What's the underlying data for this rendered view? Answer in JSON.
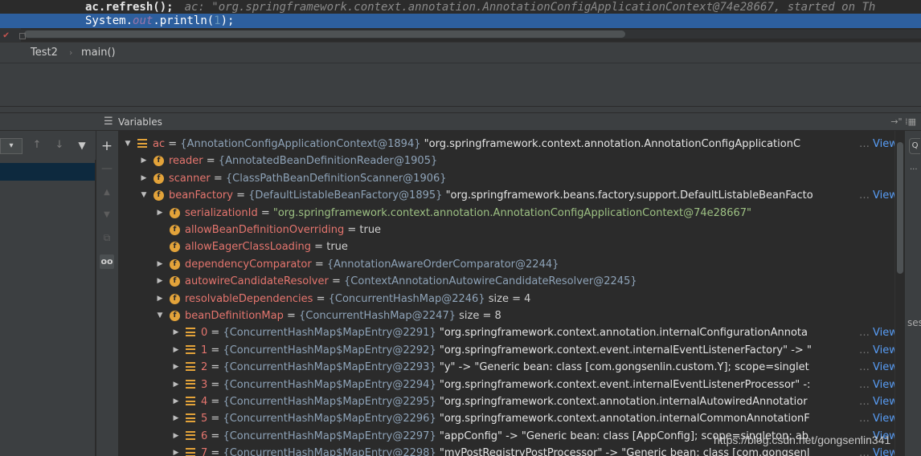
{
  "editor": {
    "line1_code": "ac.refresh();",
    "line1_hint": "ac: \"org.springframework.context.annotation.AnnotationConfigApplicationContext@74e28667, started on Th",
    "line2_prefix": "System.",
    "line2_field": "out",
    "line2_call": ".println(",
    "line2_number": "1",
    "line2_end": ");"
  },
  "breadcrumb": {
    "file": "Test2",
    "separator": "›",
    "method": "main()"
  },
  "variables_panel": {
    "title": "Variables",
    "header_right": "→\" ⁞▦"
  },
  "frames_toolbar": {
    "dropdown": "▾",
    "up": "↑",
    "down": "↓",
    "filter": "▼"
  },
  "side_tools": {
    "add": "+",
    "remove": "—",
    "up": "▲",
    "down": "▼",
    "copy": "⧉",
    "watch": "oo"
  },
  "right_edge": {
    "search": "Q",
    "more": "...",
    "text": "ses"
  },
  "tree": [
    {
      "depth": 0,
      "expand": "▼",
      "icon": "list",
      "name": "ac",
      "type": "{AnnotationConfigApplicationContext@1894}",
      "value": "\"org.springframework.context.annotation.AnnotationConfigApplicationC",
      "value_kind": "str",
      "truncated": true,
      "view": "View"
    },
    {
      "depth": 1,
      "expand": "▶",
      "icon": "f",
      "name": "reader",
      "type": "{AnnotatedBeanDefinitionReader@1905}",
      "value": "",
      "value_kind": "",
      "truncated": false,
      "view": ""
    },
    {
      "depth": 1,
      "expand": "▶",
      "icon": "f",
      "name": "scanner",
      "type": "{ClassPathBeanDefinitionScanner@1906}",
      "value": "",
      "value_kind": "",
      "truncated": false,
      "view": ""
    },
    {
      "depth": 1,
      "expand": "▼",
      "icon": "f",
      "name": "beanFactory",
      "type": "{DefaultListableBeanFactory@1895}",
      "value": "\"org.springframework.beans.factory.support.DefaultListableBeanFacto",
      "value_kind": "str",
      "truncated": true,
      "view": "View"
    },
    {
      "depth": 2,
      "expand": "▶",
      "icon": "f",
      "name": "serializationId",
      "type": "",
      "value": "\"org.springframework.context.annotation.AnnotationConfigApplicationContext@74e28667\"",
      "value_kind": "strg",
      "truncated": false,
      "view": ""
    },
    {
      "depth": 2,
      "expand": "",
      "icon": "f",
      "name": "allowBeanDefinitionOverriding",
      "type": "",
      "value": "true",
      "value_kind": "val",
      "truncated": false,
      "view": ""
    },
    {
      "depth": 2,
      "expand": "",
      "icon": "f",
      "name": "allowEagerClassLoading",
      "type": "",
      "value": "true",
      "value_kind": "val",
      "truncated": false,
      "view": ""
    },
    {
      "depth": 2,
      "expand": "▶",
      "icon": "f",
      "name": "dependencyComparator",
      "type": "{AnnotationAwareOrderComparator@2244}",
      "value": "",
      "value_kind": "",
      "truncated": false,
      "view": ""
    },
    {
      "depth": 2,
      "expand": "▶",
      "icon": "f",
      "name": "autowireCandidateResolver",
      "type": "{ContextAnnotationAutowireCandidateResolver@2245}",
      "value": "",
      "value_kind": "",
      "truncated": false,
      "view": ""
    },
    {
      "depth": 2,
      "expand": "▶",
      "icon": "f",
      "name": "resolvableDependencies",
      "type": "{ConcurrentHashMap@2246}",
      "value": "size = 4",
      "value_kind": "val",
      "truncated": false,
      "view": ""
    },
    {
      "depth": 2,
      "expand": "▼",
      "icon": "f",
      "name": "beanDefinitionMap",
      "type": "{ConcurrentHashMap@2247}",
      "value": "size = 8",
      "value_kind": "val",
      "truncated": false,
      "view": ""
    },
    {
      "depth": 3,
      "expand": "▶",
      "icon": "list",
      "name": "0",
      "type": "{ConcurrentHashMap$MapEntry@2291}",
      "value": "\"org.springframework.context.annotation.internalConfigurationAnnota",
      "value_kind": "str",
      "truncated": true,
      "view": "View"
    },
    {
      "depth": 3,
      "expand": "▶",
      "icon": "list",
      "name": "1",
      "type": "{ConcurrentHashMap$MapEntry@2292}",
      "value": "\"org.springframework.context.event.internalEventListenerFactory\" -> \"",
      "value_kind": "str",
      "truncated": true,
      "view": "View"
    },
    {
      "depth": 3,
      "expand": "▶",
      "icon": "list",
      "name": "2",
      "type": "{ConcurrentHashMap$MapEntry@2293}",
      "value": "\"y\" -> \"Generic bean: class [com.gongsenlin.custom.Y]; scope=singlet",
      "value_kind": "str",
      "truncated": true,
      "view": "View"
    },
    {
      "depth": 3,
      "expand": "▶",
      "icon": "list",
      "name": "3",
      "type": "{ConcurrentHashMap$MapEntry@2294}",
      "value": "\"org.springframework.context.event.internalEventListenerProcessor\" -:",
      "value_kind": "str",
      "truncated": true,
      "view": "View"
    },
    {
      "depth": 3,
      "expand": "▶",
      "icon": "list",
      "name": "4",
      "type": "{ConcurrentHashMap$MapEntry@2295}",
      "value": "\"org.springframework.context.annotation.internalAutowiredAnnotatior",
      "value_kind": "str",
      "truncated": true,
      "view": "View"
    },
    {
      "depth": 3,
      "expand": "▶",
      "icon": "list",
      "name": "5",
      "type": "{ConcurrentHashMap$MapEntry@2296}",
      "value": "\"org.springframework.context.annotation.internalCommonAnnotationF",
      "value_kind": "str",
      "truncated": true,
      "view": "View"
    },
    {
      "depth": 3,
      "expand": "▶",
      "icon": "list",
      "name": "6",
      "type": "{ConcurrentHashMap$MapEntry@2297}",
      "value": "\"appConfig\" -> \"Generic bean: class [AppConfig]; scope=singleton; ab",
      "value_kind": "str",
      "truncated": true,
      "view": "View"
    },
    {
      "depth": 3,
      "expand": "▶",
      "icon": "list",
      "name": "7",
      "type": "{ConcurrentHashMap$MapEntry@2298}",
      "value": "\"myPostRegistryPostProcessor\" -> \"Generic bean: class [com.gongsenl",
      "value_kind": "str",
      "truncated": true,
      "view": "View"
    }
  ],
  "watermark": "https://blog.csdn.net/gongsenlin341",
  "colors": {
    "background": "#2b2b2b",
    "panel": "#3c3f41",
    "selection": "#2d5f9e",
    "field_name": "#e5756e",
    "type_ref": "#8ea3b8",
    "string_value": "#9dc083",
    "link": "#589df6",
    "field_icon": "#e3a33a"
  }
}
